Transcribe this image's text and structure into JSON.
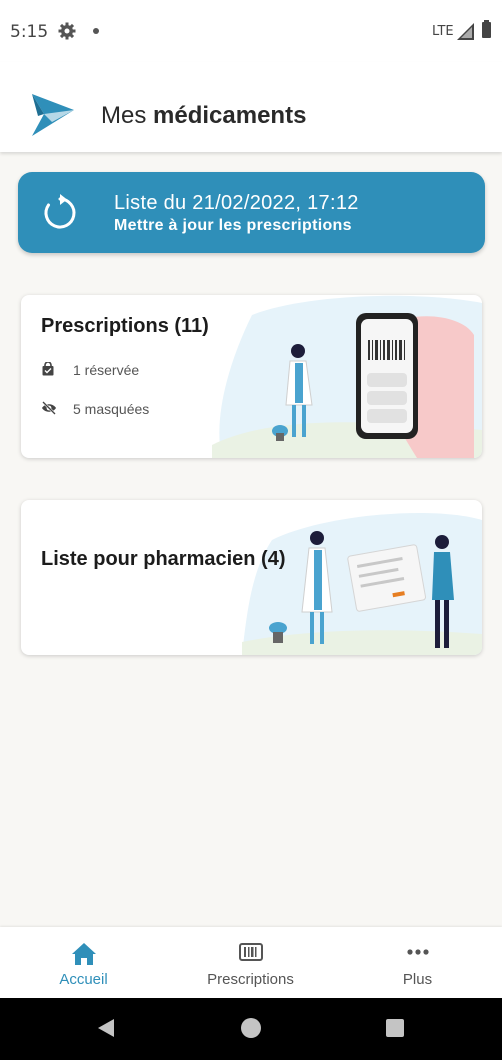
{
  "status_bar": {
    "time": "5:15",
    "network": "LTE",
    "icons": [
      "gear-icon",
      "notification-dot-icon",
      "signal-icon",
      "battery-icon"
    ]
  },
  "app_bar": {
    "title_regular": "Mes",
    "title_bold": "médicaments"
  },
  "update_button": {
    "line1": "Liste du 21/02/2022, 17:12",
    "line2": "Mettre à jour les prescriptions",
    "icon": "refresh-icon"
  },
  "cards": {
    "prescriptions": {
      "title": "Prescriptions (11)",
      "reserved": "1 réservée",
      "hidden": "5 masquées"
    },
    "pharmacist": {
      "title": "Liste pour pharmacien (4)"
    }
  },
  "bottom_nav": {
    "items": [
      {
        "label": "Accueil",
        "icon": "home-icon"
      },
      {
        "label": "Prescriptions",
        "icon": "barcode-icon"
      },
      {
        "label": "Plus",
        "icon": "more-icon"
      }
    ]
  },
  "colors": {
    "accent": "#2f8fb9",
    "background": "#f8f7f4",
    "illustration_blue": "#e6f3fa",
    "illustration_pink": "#f7c9c9"
  }
}
